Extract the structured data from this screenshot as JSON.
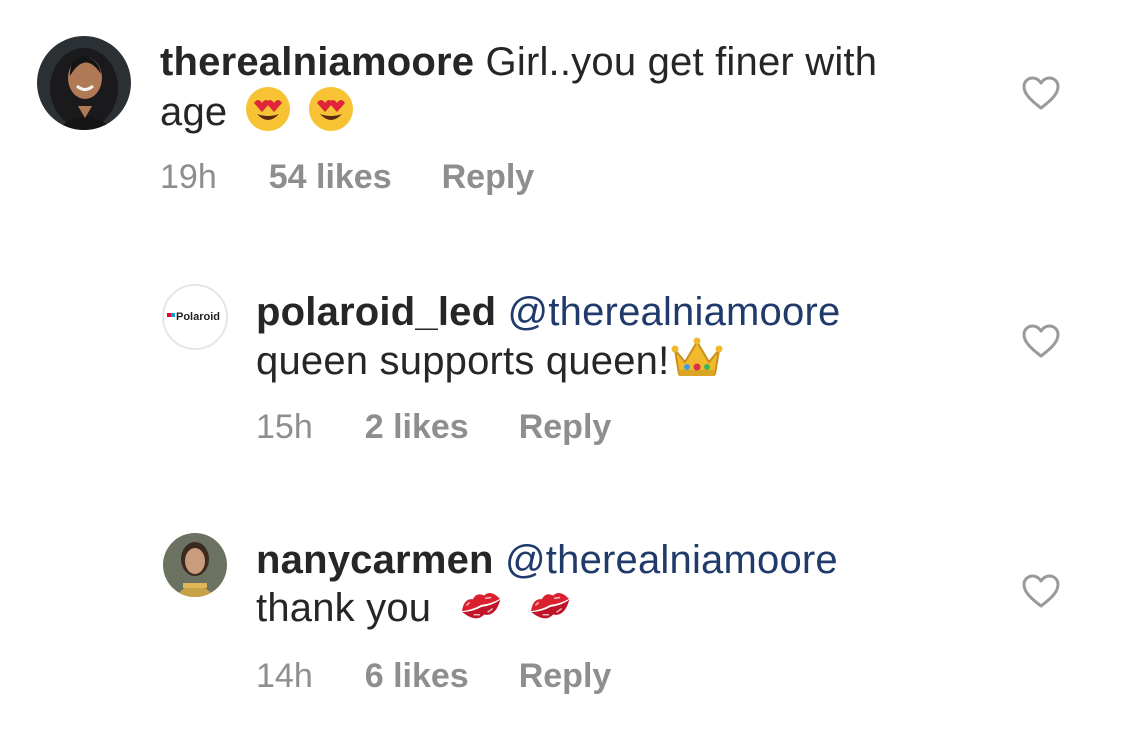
{
  "comments": [
    {
      "username": "therealniamoore",
      "mention": "",
      "text_line1": "Girl..you get finer with",
      "text_line2": "age",
      "emojis": [
        "heart-eyes-emoji",
        "heart-eyes-emoji"
      ],
      "time": "19h",
      "likes": "54 likes",
      "reply": "Reply",
      "avatar": "profile-photo"
    },
    {
      "username": "polaroid_led",
      "mention": "@therealniamoore",
      "text_line2": "queen supports queen!",
      "emojis": [
        "crown-emoji"
      ],
      "time": "15h",
      "likes": "2 likes",
      "reply": "Reply",
      "avatar_logo_text": "Polaroid"
    },
    {
      "username": "nanycarmen",
      "mention": "@therealniamoore",
      "text_line2": "thank you",
      "emojis": [
        "kiss-mark-emoji",
        "kiss-mark-emoji"
      ],
      "time": "14h",
      "likes": "6 likes",
      "reply": "Reply",
      "avatar": "profile-photo"
    }
  ],
  "colors": {
    "text": "#262626",
    "meta": "#8e8e8e",
    "mention": "#1f3a6b",
    "heart_outline": "#9a9a9a"
  },
  "icons": [
    "heart-outline-icon"
  ]
}
